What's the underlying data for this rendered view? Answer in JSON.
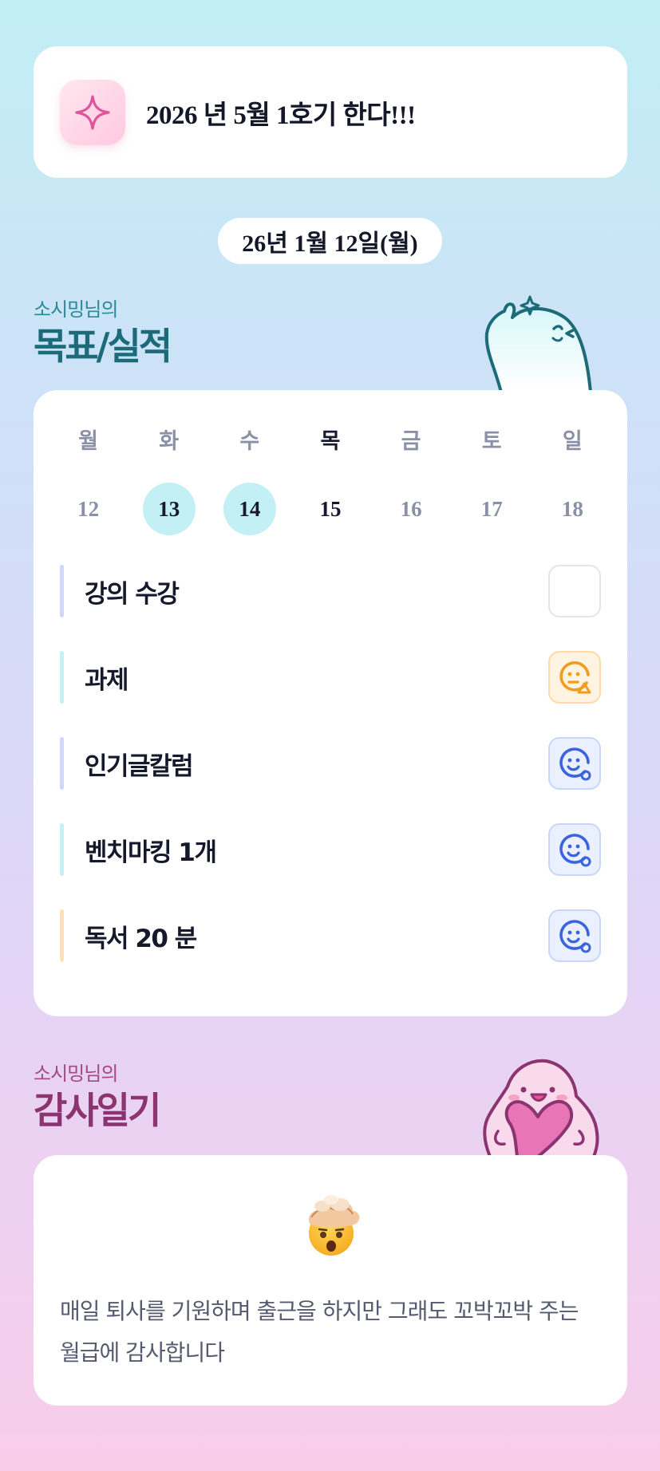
{
  "banner": {
    "text": "2026 년 5월 1호기 한다!!!",
    "icon": "sparkle-icon"
  },
  "date_label": "26년 1월 12일(월)",
  "goals_section": {
    "subtitle": "소시밍님의",
    "title": "목표/실적"
  },
  "week": {
    "days": [
      {
        "name": "월",
        "num": "12",
        "state": "none"
      },
      {
        "name": "화",
        "num": "13",
        "state": "done"
      },
      {
        "name": "수",
        "num": "14",
        "state": "done"
      },
      {
        "name": "목",
        "num": "15",
        "state": "today"
      },
      {
        "name": "금",
        "num": "16",
        "state": "none"
      },
      {
        "name": "토",
        "num": "17",
        "state": "none"
      },
      {
        "name": "일",
        "num": "18",
        "state": "none"
      }
    ]
  },
  "goals": [
    {
      "label": "강의 수강",
      "bar_color": "#cfd8fb",
      "status": "empty"
    },
    {
      "label": "과제",
      "bar_color": "#c3f0f4",
      "status": "partial-face-icon"
    },
    {
      "label": "인기글칼럼",
      "bar_color": "#cfd8fb",
      "status": "smile-face-icon"
    },
    {
      "label": "벤치마킹 1개",
      "bar_color": "#c3f0f4",
      "status": "smile-face-icon"
    },
    {
      "label": "독서 20 분",
      "bar_color": "#ffe0b8",
      "status": "smile-face-icon"
    }
  ],
  "gratitude_section": {
    "subtitle": "소시밍님의",
    "title": "감사일기"
  },
  "gratitude": {
    "emoji": "exploding-head-icon",
    "text": "매일 퇴사를 기원하며 출근을 하지만 그래도 꼬박꼬박 주는 월급에 감사합니다"
  },
  "colors": {
    "accent_teal": "#1d6b78",
    "accent_plum": "#8b3470",
    "done_day": "#c3f0f4",
    "partial_orange": "#f29b1d",
    "complete_blue": "#3b63e0"
  }
}
